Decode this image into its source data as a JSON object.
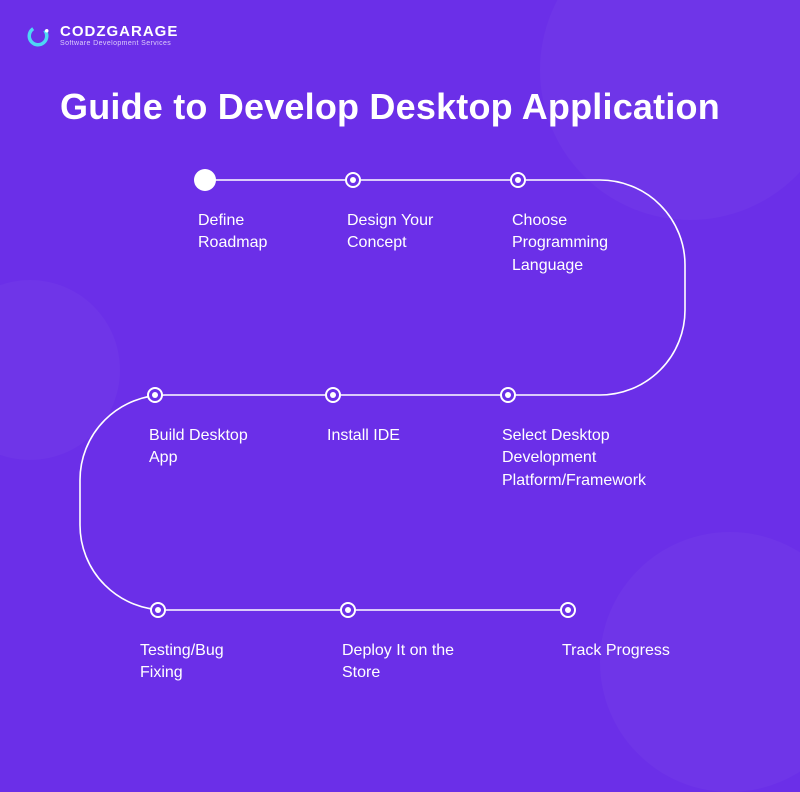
{
  "brand": {
    "name": "CODZGARAGE",
    "tagline": "Software Development Services"
  },
  "title": "Guide to Develop Desktop Application",
  "steps": [
    {
      "label": "Define Roadmap"
    },
    {
      "label": "Design Your Concept"
    },
    {
      "label": "Choose Programming Language"
    },
    {
      "label": "Select Desktop Development Platform/Framework"
    },
    {
      "label": "Install IDE"
    },
    {
      "label": "Build Desktop App"
    },
    {
      "label": "Testing/Bug Fixing"
    },
    {
      "label": "Deploy It on the Store"
    },
    {
      "label": "Track Progress"
    }
  ]
}
